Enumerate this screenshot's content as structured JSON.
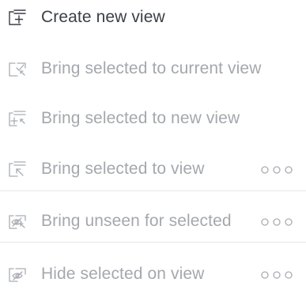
{
  "colors": {
    "enabled_text": "#3a3f47",
    "disabled_text": "#a4a8ad",
    "disabled_icon": "#a9adb2",
    "divider": "#e4e6e9"
  },
  "menu": {
    "items": [
      {
        "label": "Create new view",
        "icon": "view-add-icon",
        "enabled": true,
        "has_more": false
      },
      {
        "label": "Bring selected to current view",
        "icon": "bring-check-icon",
        "enabled": false,
        "has_more": false
      },
      {
        "label": "Bring selected to new view",
        "icon": "bring-add-icon",
        "enabled": false,
        "has_more": false
      },
      {
        "label": "Bring selected to view",
        "icon": "bring-to-view-icon",
        "enabled": false,
        "has_more": true
      },
      {
        "label": "Bring unseen for selected",
        "icon": "bring-unseen-icon",
        "enabled": false,
        "has_more": true
      },
      {
        "label": "Hide selected on view",
        "icon": "hide-on-view-icon",
        "enabled": false,
        "has_more": true
      }
    ],
    "more_icon": "more-options-icon"
  }
}
